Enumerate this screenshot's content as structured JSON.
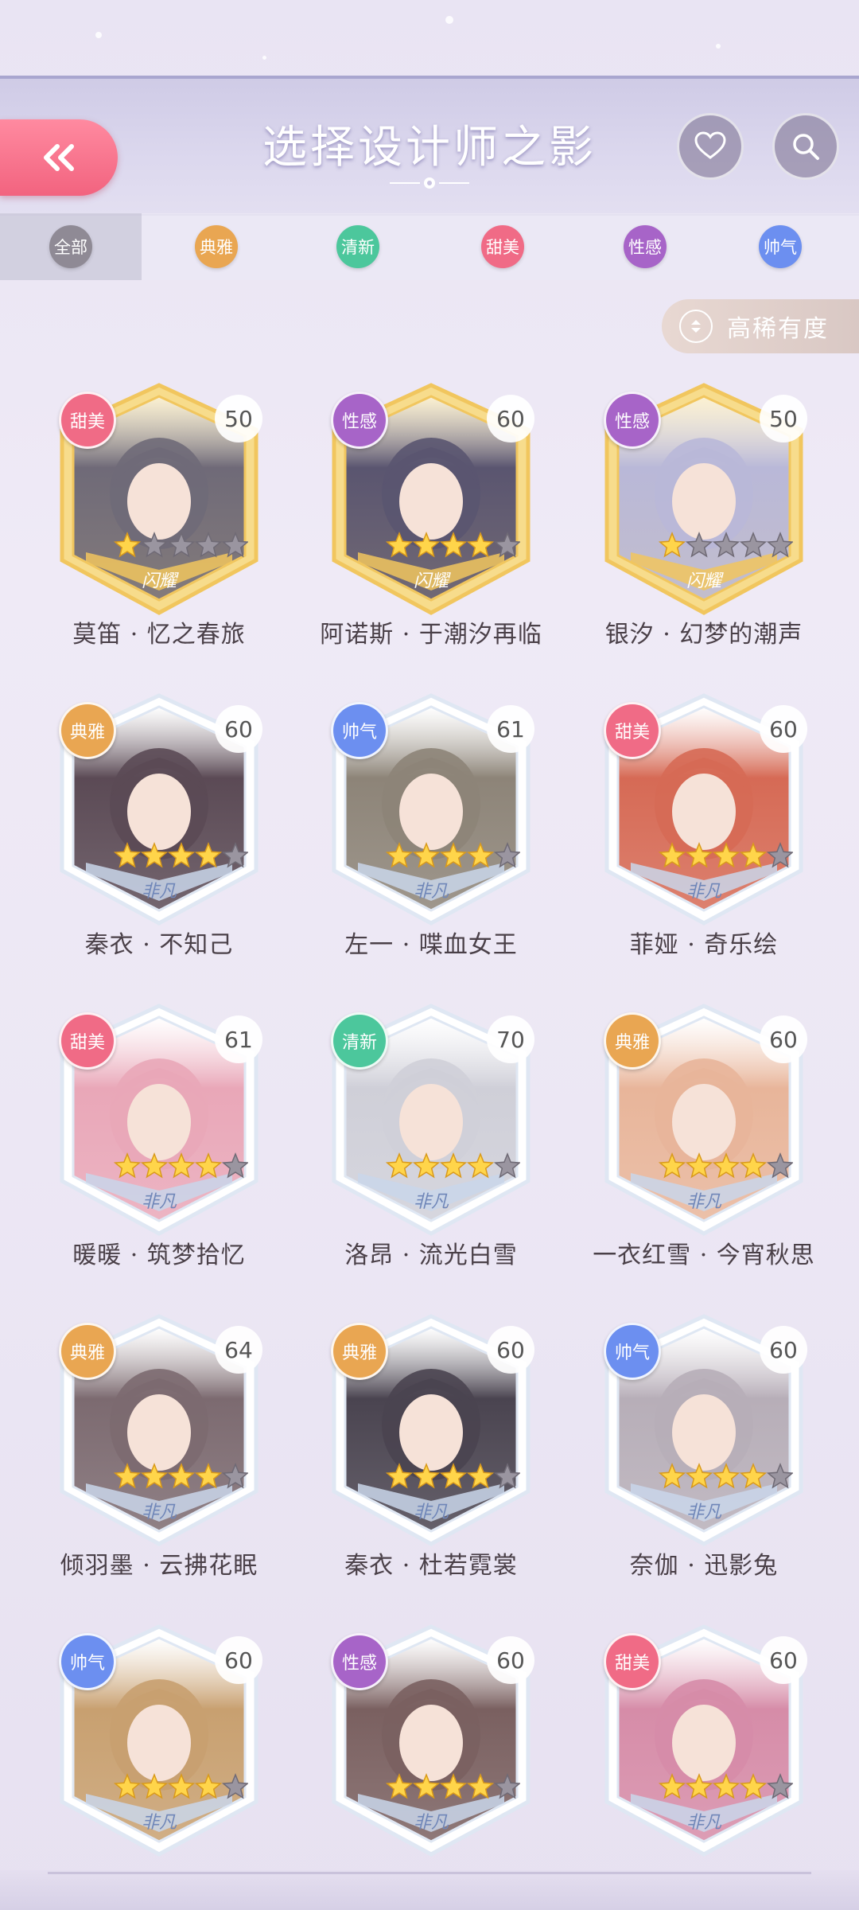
{
  "header": {
    "title": "选择设计师之影",
    "back_icon": "double-chevron-left-icon",
    "favorite_icon": "heart-icon",
    "search_icon": "search-icon"
  },
  "tabs": [
    {
      "label": "全部",
      "color": "#8f8a95",
      "active": true
    },
    {
      "label": "典雅",
      "color": "#e9a652"
    },
    {
      "label": "清新",
      "color": "#4cc79c"
    },
    {
      "label": "甜美",
      "color": "#f06b86"
    },
    {
      "label": "性感",
      "color": "#a764c8"
    },
    {
      "label": "帅气",
      "color": "#6c8ff0"
    }
  ],
  "sort": {
    "label": "高稀有度",
    "icon": "sort-updown-icon"
  },
  "cards": [
    {
      "name": "莫笛 · 忆之春旅",
      "tag": "甜美",
      "level": "50",
      "stars": 1,
      "tier": "gold",
      "rank": "闪耀"
    },
    {
      "name": "阿诺斯 · 于潮汐再临",
      "tag": "性感",
      "level": "60",
      "stars": 4,
      "tier": "gold",
      "rank": "闪耀"
    },
    {
      "name": "银汐 · 幻梦的潮声",
      "tag": "性感",
      "level": "50",
      "stars": 1,
      "tier": "gold",
      "rank": "闪耀"
    },
    {
      "name": "秦衣 · 不知己",
      "tag": "典雅",
      "level": "60",
      "stars": 4,
      "tier": "silver",
      "rank": "非凡"
    },
    {
      "name": "左一 · 喋血女王",
      "tag": "帅气",
      "level": "61",
      "stars": 4,
      "tier": "silver",
      "rank": "非凡"
    },
    {
      "name": "菲娅 · 奇乐绘",
      "tag": "甜美",
      "level": "60",
      "stars": 4,
      "tier": "silver",
      "rank": "非凡"
    },
    {
      "name": "暖暖 · 筑梦拾忆",
      "tag": "甜美",
      "level": "61",
      "stars": 4,
      "tier": "silver",
      "rank": "非凡"
    },
    {
      "name": "洛昂 · 流光白雪",
      "tag": "清新",
      "level": "70",
      "stars": 4,
      "tier": "silver",
      "rank": "非凡"
    },
    {
      "name": "一衣红雪 · 今宵秋思",
      "tag": "典雅",
      "level": "60",
      "stars": 4,
      "tier": "silver",
      "rank": "非凡"
    },
    {
      "name": "倾羽墨 · 云拂花眠",
      "tag": "典雅",
      "level": "64",
      "stars": 4,
      "tier": "silver",
      "rank": "非凡"
    },
    {
      "name": "秦衣 · 杜若霓裳",
      "tag": "典雅",
      "level": "60",
      "stars": 4,
      "tier": "silver",
      "rank": "非凡"
    },
    {
      "name": "奈伽 · 迅影兔",
      "tag": "帅气",
      "level": "60",
      "stars": 4,
      "tier": "silver",
      "rank": "非凡"
    },
    {
      "name": "",
      "tag": "帅气",
      "level": "60",
      "stars": 4,
      "tier": "silver",
      "rank": "非凡"
    },
    {
      "name": "",
      "tag": "性感",
      "level": "60",
      "stars": 4,
      "tier": "silver",
      "rank": "非凡"
    },
    {
      "name": "",
      "tag": "甜美",
      "level": "60",
      "stars": 4,
      "tier": "silver",
      "rank": "非凡"
    }
  ],
  "tag_colors": {
    "典雅": "#e9a652",
    "清新": "#4cc79c",
    "甜美": "#f06b86",
    "性感": "#a764c8",
    "帅气": "#6c8ff0"
  },
  "portrait_colors": [
    "#6f6a78",
    "#5a5570",
    "#b9b8d8",
    "#5b4a55",
    "#8d8478",
    "#d66a55",
    "#e9a7b8",
    "#cfcfd8",
    "#e8b59a",
    "#7c6a70",
    "#4a4450",
    "#b7aeb8",
    "#c8a070",
    "#7a6060",
    "#d68ca8"
  ]
}
